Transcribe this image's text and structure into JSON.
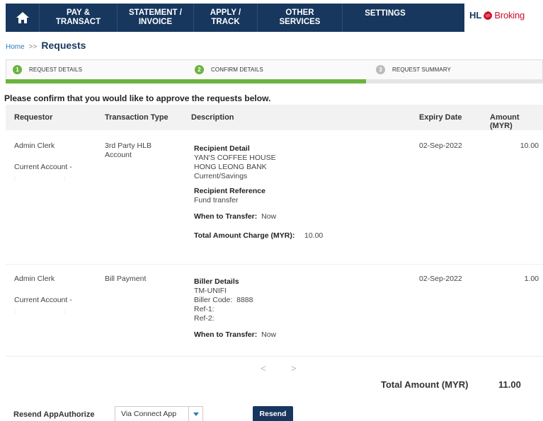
{
  "nav": {
    "items": [
      "PAY &\nTRANSACT",
      "STATEMENT /\nINVOICE",
      "APPLY /\nTRACK",
      "OTHER\nSERVICES",
      "SETTINGS"
    ],
    "brand_prefix": "HL",
    "brand_name": "Broking"
  },
  "breadcrumb": {
    "home": "Home",
    "sep": ">>",
    "title": "Requests"
  },
  "steps": [
    {
      "num": "1",
      "label": "REQUEST DETAILS"
    },
    {
      "num": "2",
      "label": "CONFIRM DETAILS"
    },
    {
      "num": "3",
      "label": "REQUEST SUMMARY"
    }
  ],
  "progress": {
    "completed_fraction": 0.67
  },
  "instruction": "Please confirm that you would like to approve the requests below.",
  "table": {
    "headers": [
      "Requestor",
      "Transaction Type",
      "Description",
      "Expiry Date",
      "Amount (MYR)"
    ],
    "rows": [
      {
        "requestor": "Admin Clerk",
        "account": "Current Account  -",
        "account_sub": ":",
        "account_sub2": ":",
        "type": "3rd Party HLB\nAccount",
        "expiry": "02-Sep-2022",
        "amount": "10.00",
        "recipient_head": "Recipient Detail",
        "recipient_name": "YAN'S COFFEE HOUSE",
        "recipient_bank": "HONG LEONG BANK",
        "recipient_type": "Current/Savings",
        "reference_head": "Recipient Reference",
        "reference_value": "Fund transfer",
        "when_label": "When to Transfer:",
        "when_value": "Now",
        "charge_label": "Total Amount Charge (MYR):",
        "charge_value": "10.00"
      },
      {
        "requestor": "Admin Clerk",
        "account": "Current Account  -",
        "account_sub": ":",
        "account_sub2": ":",
        "type": "Bill Payment",
        "expiry": "02-Sep-2022",
        "amount": "1.00",
        "biller_head": "Biller Details",
        "biller_name": "TM-UNIFI",
        "biller_code_label": "Biller Code:",
        "biller_code": "8888",
        "ref1": "Ref-1:",
        "ref2": "Ref-2:",
        "when_label": "When to Transfer:",
        "when_value": "Now"
      }
    ]
  },
  "pager": {
    "prev": "<",
    "next": ">"
  },
  "total": {
    "label": "Total Amount (MYR)",
    "value": "11.00"
  },
  "footer": {
    "resend_label": "Resend AppAuthorize",
    "method_selected": "Via Connect App",
    "resend_button": "Resend"
  },
  "colors": {
    "nav": "#17375e",
    "accent_green": "#6cb33f",
    "brand_red": "#c8102e"
  }
}
